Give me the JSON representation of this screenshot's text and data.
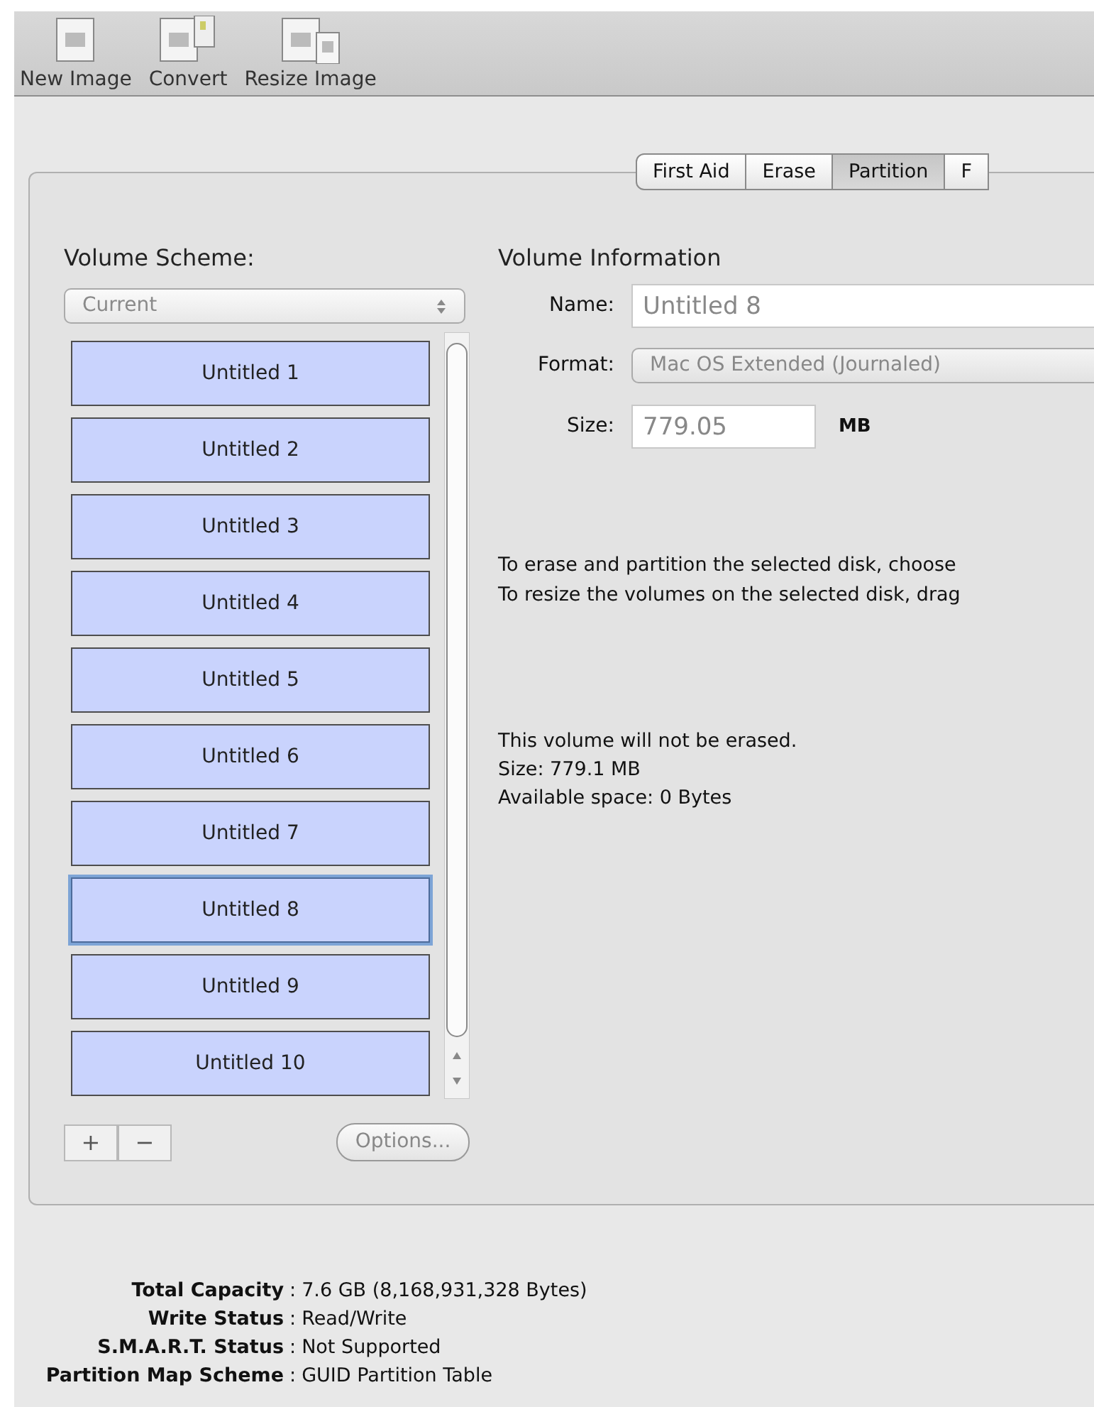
{
  "toolbar": {
    "items": [
      {
        "label": "New Image",
        "kind": "disk"
      },
      {
        "label": "Convert",
        "kind": "convert"
      },
      {
        "label": "Resize Image",
        "kind": "resize"
      }
    ]
  },
  "tabs": [
    {
      "label": "First Aid",
      "selected": false
    },
    {
      "label": "Erase",
      "selected": false
    },
    {
      "label": "Partition",
      "selected": true
    },
    {
      "label": "F",
      "selected": false
    }
  ],
  "volume_scheme": {
    "title": "Volume Scheme:",
    "select": {
      "value": "Current",
      "disabled": true
    },
    "partitions": [
      {
        "label": "Untitled 1",
        "selected": false
      },
      {
        "label": "Untitled 2",
        "selected": false
      },
      {
        "label": "Untitled 3",
        "selected": false
      },
      {
        "label": "Untitled 4",
        "selected": false
      },
      {
        "label": "Untitled 5",
        "selected": false
      },
      {
        "label": "Untitled 6",
        "selected": false
      },
      {
        "label": "Untitled 7",
        "selected": false
      },
      {
        "label": "Untitled 8",
        "selected": true
      },
      {
        "label": "Untitled 9",
        "selected": false
      },
      {
        "label": "Untitled 10",
        "selected": false
      }
    ],
    "add_button": "+",
    "remove_button": "−",
    "options_button": {
      "label": "Options...",
      "disabled": true
    }
  },
  "volume_information": {
    "title": "Volume Information",
    "name": {
      "label": "Name:",
      "value": "Untitled 8"
    },
    "format": {
      "label": "Format:",
      "value": "Mac OS Extended (Journaled)",
      "disabled": true
    },
    "size": {
      "label": "Size:",
      "value": "779.05",
      "unit": "MB"
    },
    "instructions": [
      "To erase and partition the selected disk, choose",
      "To resize the volumes on the selected disk, drag"
    ],
    "details": [
      "This volume will not be erased.",
      "Size: 779.1 MB",
      "Available space: 0 Bytes"
    ]
  },
  "disk_info": [
    {
      "label": "Total Capacity",
      "separator": ":",
      "value": "7.6 GB (8,168,931,328 Bytes)"
    },
    {
      "label": "Write Status",
      "separator": ":",
      "value": "Read/Write"
    },
    {
      "label": "S.M.A.R.T. Status",
      "separator": ":",
      "value": "Not Supported"
    },
    {
      "label": "Partition Map Scheme",
      "separator": ":",
      "value": "GUID Partition Table"
    }
  ]
}
